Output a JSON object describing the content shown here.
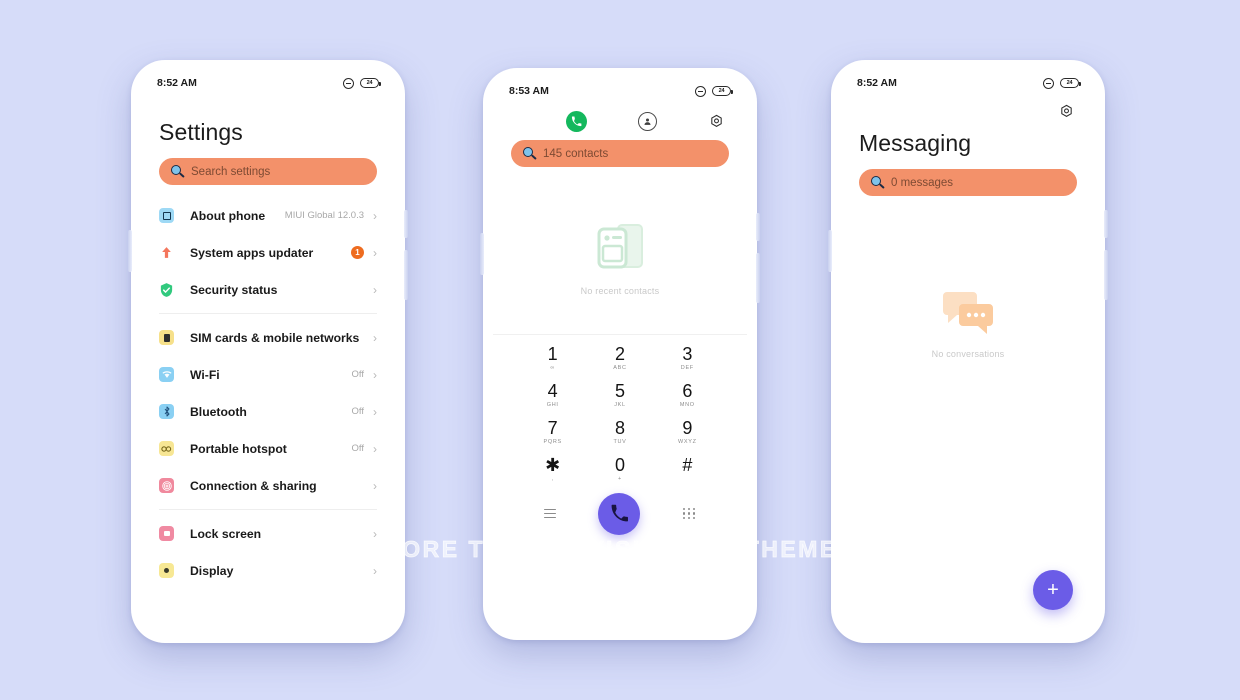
{
  "background_color": "#d6dcf9",
  "accent_colors": {
    "search_bar": "#f3916a",
    "purple": "#6b5ce7",
    "badge_orange": "#ee6c20",
    "green": "#14b85d"
  },
  "watermark": "FOR MORE THEMES VISIT - MIUITHEMEZ.COM",
  "phone_settings": {
    "status_bar": {
      "time": "8:52 AM",
      "dnd_icon": "do-not-disturb-icon",
      "battery_level": "24"
    },
    "title": "Settings",
    "search": {
      "placeholder": "Search settings",
      "icon": "search-icon"
    },
    "groups": [
      {
        "items": [
          {
            "label": "About phone",
            "value": "MIUI Global 12.0.3",
            "icon": "about-phone-icon",
            "icon_class": "ic-phone",
            "glyph": "",
            "badge": null
          },
          {
            "label": "System apps updater",
            "value": "",
            "icon": "system-update-icon",
            "icon_class": "ic-arrow",
            "glyph": "⬆",
            "badge": "1"
          },
          {
            "label": "Security status",
            "value": "",
            "icon": "security-shield-icon",
            "icon_class": "ic-shield",
            "glyph": "",
            "badge": null
          }
        ]
      },
      {
        "items": [
          {
            "label": "SIM cards & mobile networks",
            "value": "",
            "icon": "sim-card-icon",
            "icon_class": "ic-sim",
            "glyph": "",
            "badge": null
          },
          {
            "label": "Wi-Fi",
            "value": "Off",
            "icon": "wifi-icon",
            "icon_class": "ic-wifi",
            "glyph": "",
            "badge": null
          },
          {
            "label": "Bluetooth",
            "value": "Off",
            "icon": "bluetooth-icon",
            "icon_class": "ic-bt",
            "glyph": "",
            "badge": null
          },
          {
            "label": "Portable hotspot",
            "value": "Off",
            "icon": "hotspot-icon",
            "icon_class": "ic-hotspot",
            "glyph": "",
            "badge": null
          },
          {
            "label": "Connection & sharing",
            "value": "",
            "icon": "connection-sharing-icon",
            "icon_class": "ic-conn",
            "glyph": "",
            "badge": null
          }
        ]
      },
      {
        "items": [
          {
            "label": "Lock screen",
            "value": "",
            "icon": "lock-screen-icon",
            "icon_class": "ic-lock",
            "glyph": "",
            "badge": null
          },
          {
            "label": "Display",
            "value": "",
            "icon": "display-icon",
            "icon_class": "ic-display",
            "glyph": "",
            "badge": null
          }
        ]
      }
    ],
    "chevron": "›"
  },
  "phone_dialer": {
    "status_bar": {
      "time": "8:53 AM",
      "dnd_icon": "do-not-disturb-icon",
      "battery_level": "24"
    },
    "top_icons": [
      {
        "name": "dialer-tab-icon",
        "glyph": "✆"
      },
      {
        "name": "contacts-tab-icon",
        "glyph": "⚹"
      },
      {
        "name": "settings-gear-icon",
        "glyph": ""
      }
    ],
    "search": {
      "value": "145 contacts",
      "icon": "search-icon"
    },
    "empty_state": {
      "caption": "No recent contacts",
      "illustration": "contact-card-illustration"
    },
    "keypad": [
      {
        "num": "1",
        "sub": "∞"
      },
      {
        "num": "2",
        "sub": "ABC"
      },
      {
        "num": "3",
        "sub": "DEF"
      },
      {
        "num": "4",
        "sub": "GHI"
      },
      {
        "num": "5",
        "sub": "JKL"
      },
      {
        "num": "6",
        "sub": "MNO"
      },
      {
        "num": "7",
        "sub": "PQRS"
      },
      {
        "num": "8",
        "sub": "TUV"
      },
      {
        "num": "9",
        "sub": "WXYZ"
      },
      {
        "num": "✱",
        "sub": ","
      },
      {
        "num": "0",
        "sub": "+"
      },
      {
        "num": "#",
        "sub": ""
      }
    ],
    "actions": {
      "menu_icon": "menu-lines-icon",
      "call_button": {
        "name": "call-button",
        "glyph": "✆"
      },
      "keypad_icon": "keypad-grid-icon"
    }
  },
  "phone_messaging": {
    "status_bar": {
      "time": "8:52 AM",
      "dnd_icon": "do-not-disturb-icon",
      "battery_level": "24"
    },
    "settings_icon": "settings-gear-icon",
    "title": "Messaging",
    "search": {
      "value": "0 messages",
      "icon": "search-icon"
    },
    "empty_state": {
      "caption": "No conversations",
      "illustration": "speech-bubbles-illustration"
    },
    "fab": {
      "name": "new-message-button",
      "glyph": "+"
    }
  }
}
